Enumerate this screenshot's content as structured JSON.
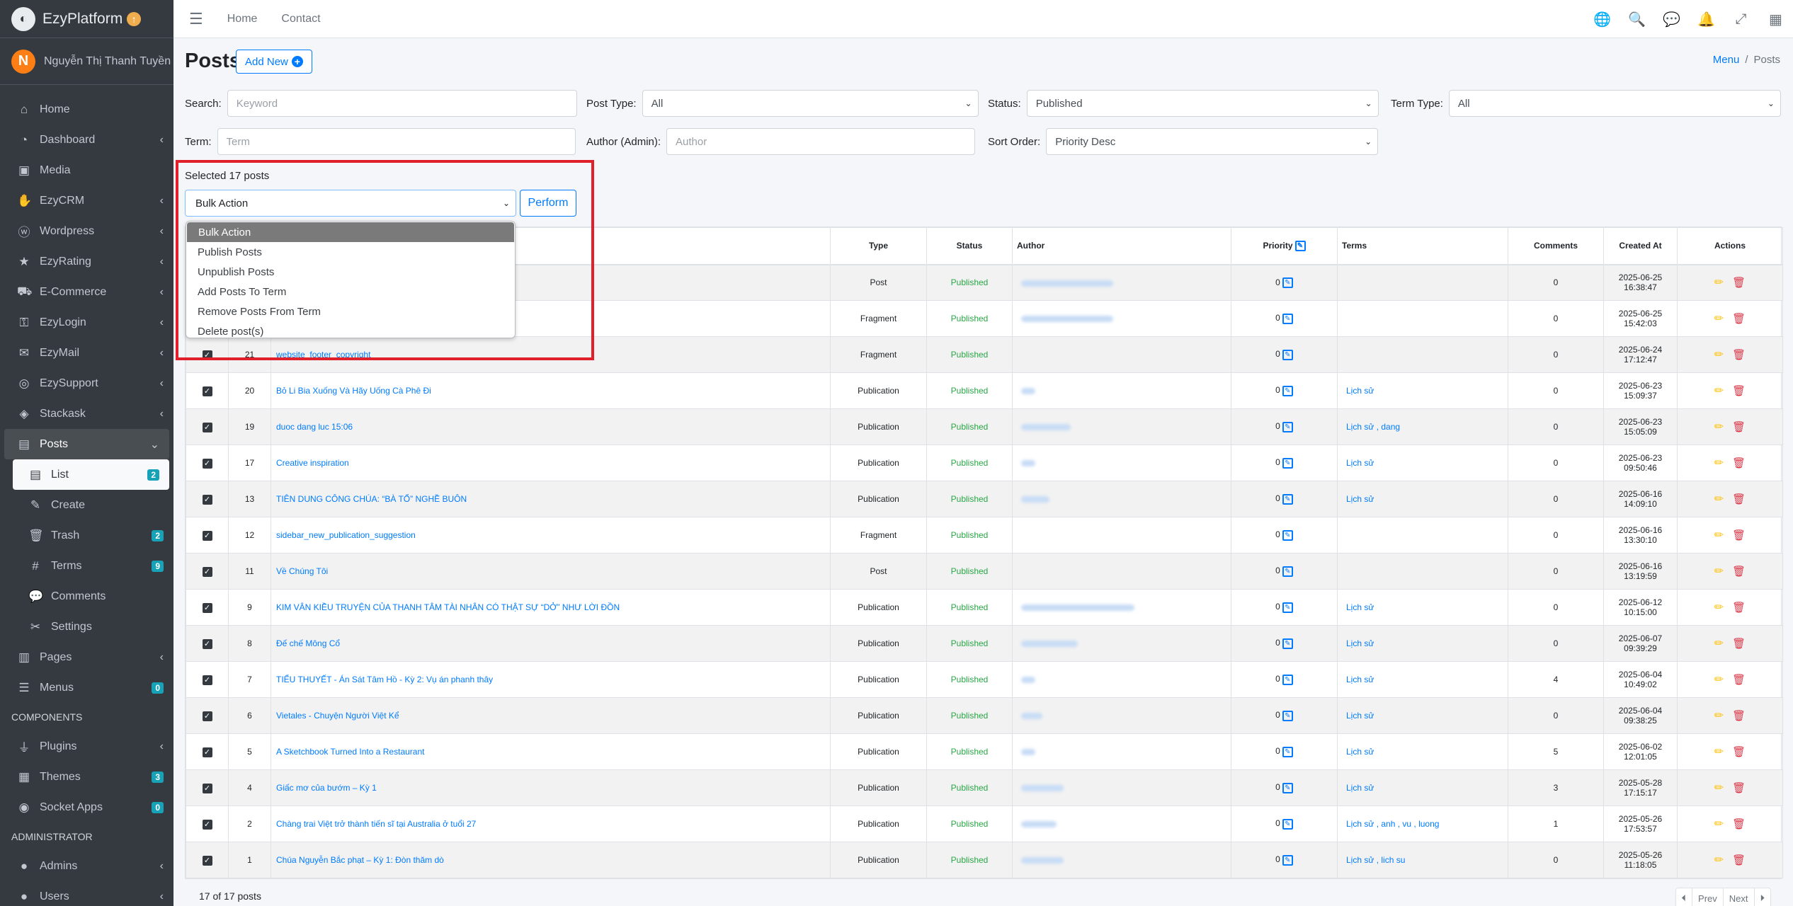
{
  "brand": {
    "name": "EzyPlatform"
  },
  "user": {
    "initial": "N",
    "name": "Nguyễn Thị Thanh Tuyền"
  },
  "sidebar": {
    "items": [
      {
        "label": "Home",
        "icon": "home-icon"
      },
      {
        "label": "Dashboard",
        "icon": "dashboard-icon"
      },
      {
        "label": "Media",
        "icon": "media-icon"
      },
      {
        "label": "EzyCRM",
        "icon": "crm-icon"
      },
      {
        "label": "Wordpress",
        "icon": "wordpress-icon"
      },
      {
        "label": "EzyRating",
        "icon": "star-icon"
      },
      {
        "label": "E-Commerce",
        "icon": "cart-icon"
      },
      {
        "label": "EzyLogin",
        "icon": "login-icon"
      },
      {
        "label": "EzyMail",
        "icon": "mail-icon"
      },
      {
        "label": "EzySupport",
        "icon": "support-icon"
      },
      {
        "label": "Stackask",
        "icon": "stack-icon"
      },
      {
        "label": "Posts",
        "icon": "posts-icon"
      }
    ],
    "posts_sub": [
      {
        "label": "List",
        "badge": "2"
      },
      {
        "label": "Create",
        "badge": ""
      },
      {
        "label": "Trash",
        "badge": "2"
      },
      {
        "label": "Terms",
        "badge": "9"
      },
      {
        "label": "Comments",
        "badge": ""
      },
      {
        "label": "Settings",
        "badge": ""
      }
    ],
    "after": [
      {
        "label": "Pages",
        "badge": ""
      },
      {
        "label": "Menus",
        "badge": "0"
      }
    ],
    "components_header": "COMPONENTS",
    "components": [
      {
        "label": "Plugins",
        "badge": ""
      },
      {
        "label": "Themes",
        "badge": "3"
      },
      {
        "label": "Socket Apps",
        "badge": "0"
      }
    ],
    "admin_header": "ADMINISTRATOR",
    "admin": [
      {
        "label": "Admins"
      },
      {
        "label": "Users"
      }
    ]
  },
  "topnav": {
    "home": "Home",
    "contact": "Contact"
  },
  "page": {
    "title": "Posts",
    "add_new": "Add New"
  },
  "breadcrumb": {
    "menu": "Menu",
    "current": "Posts"
  },
  "filters": {
    "search_label": "Search:",
    "search_placeholder": "Keyword",
    "post_type_label": "Post Type:",
    "post_type_value": "All",
    "status_label": "Status:",
    "status_value": "Published",
    "term_type_label": "Term Type:",
    "term_type_value": "All",
    "term_label": "Term:",
    "term_placeholder": "Term",
    "author_label": "Author (Admin):",
    "author_placeholder": "Author",
    "sort_label": "Sort Order:",
    "sort_value": "Priority Desc"
  },
  "bulk": {
    "selected_text": "Selected 17 posts",
    "select_value": "Bulk Action",
    "perform": "Perform",
    "options": [
      "Bulk Action",
      "Publish Posts",
      "Unpublish Posts",
      "Add Posts To Term",
      "Remove Posts From Term",
      "Delete post(s)"
    ]
  },
  "table": {
    "headers": {
      "type": "Type",
      "status": "Status",
      "author": "Author",
      "priority": "Priority",
      "terms": "Terms",
      "comments": "Comments",
      "created_at": "Created At",
      "actions": "Actions"
    },
    "rows": [
      {
        "id": "",
        "title": "",
        "type": "Post",
        "status": "Published",
        "priority": "0",
        "terms": "",
        "comments": "0",
        "created": "2025-06-25 16:38:47"
      },
      {
        "id": "",
        "title": "",
        "type": "Fragment",
        "status": "Published",
        "priority": "0",
        "terms": "",
        "comments": "0",
        "created": "2025-06-25 15:42:03"
      },
      {
        "id": "21",
        "title": "website_footer_copyright",
        "type": "Fragment",
        "status": "Published",
        "priority": "0",
        "terms": "",
        "comments": "0",
        "created": "2025-06-24 17:12:47"
      },
      {
        "id": "20",
        "title": "Bỏ Li Bia Xuống Và Hãy Uống Cà Phê Đi",
        "type": "Publication",
        "status": "Published",
        "priority": "0",
        "terms": "Lịch sử",
        "comments": "0",
        "created": "2025-06-23 15:09:37"
      },
      {
        "id": "19",
        "title": "duoc dang luc 15:06",
        "type": "Publication",
        "status": "Published",
        "priority": "0",
        "terms": "Lịch sử , dang",
        "comments": "0",
        "created": "2025-06-23 15:05:09"
      },
      {
        "id": "17",
        "title": "Creative inspiration",
        "type": "Publication",
        "status": "Published",
        "priority": "0",
        "terms": "Lịch sử",
        "comments": "0",
        "created": "2025-06-23 09:50:46"
      },
      {
        "id": "13",
        "title": "TIÊN DUNG CÔNG CHÚA: “BÀ TỔ” NGHỀ BUÔN",
        "type": "Publication",
        "status": "Published",
        "priority": "0",
        "terms": "Lịch sử",
        "comments": "0",
        "created": "2025-06-16 14:09:10"
      },
      {
        "id": "12",
        "title": "sidebar_new_publication_suggestion",
        "type": "Fragment",
        "status": "Published",
        "priority": "0",
        "terms": "",
        "comments": "0",
        "created": "2025-06-16 13:30:10"
      },
      {
        "id": "11",
        "title": "Về Chúng Tôi",
        "type": "Post",
        "status": "Published",
        "priority": "0",
        "terms": "",
        "comments": "0",
        "created": "2025-06-16 13:19:59"
      },
      {
        "id": "9",
        "title": "KIM VÂN KIỀU TRUYỆN CỦA THANH TÂM TÀI NHÂN CÓ THẬT SỰ “DỞ” NHƯ LỜI ĐỒN",
        "type": "Publication",
        "status": "Published",
        "priority": "0",
        "terms": "Lịch sử",
        "comments": "0",
        "created": "2025-06-12 10:15:00"
      },
      {
        "id": "8",
        "title": "Đế chế Mông Cổ",
        "type": "Publication",
        "status": "Published",
        "priority": "0",
        "terms": "Lịch sử",
        "comments": "0",
        "created": "2025-06-07 09:39:29"
      },
      {
        "id": "7",
        "title": "TIỂU THUYẾT - Án Sát Tâm Hồ - Kỳ 2: Vụ án phanh thây",
        "type": "Publication",
        "status": "Published",
        "priority": "0",
        "terms": "Lịch sử",
        "comments": "4",
        "created": "2025-06-04 10:49:02"
      },
      {
        "id": "6",
        "title": "Vietales - Chuyện Người Việt Kể",
        "type": "Publication",
        "status": "Published",
        "priority": "0",
        "terms": "Lịch sử",
        "comments": "0",
        "created": "2025-06-04 09:38:25"
      },
      {
        "id": "5",
        "title": "A Sketchbook Turned Into a Restaurant",
        "type": "Publication",
        "status": "Published",
        "priority": "0",
        "terms": "Lịch sử",
        "comments": "5",
        "created": "2025-06-02 12:01:05"
      },
      {
        "id": "4",
        "title": "Giấc mơ của bướm – Kỳ 1",
        "type": "Publication",
        "status": "Published",
        "priority": "0",
        "terms": "Lịch sử",
        "comments": "3",
        "created": "2025-05-28 17:15:17"
      },
      {
        "id": "2",
        "title": "Chàng trai Việt trở thành tiến sĩ tại Australia ở tuổi 27",
        "type": "Publication",
        "status": "Published",
        "priority": "0",
        "terms": "Lịch sử , anh , vu , luong",
        "comments": "1",
        "created": "2025-05-26 17:53:57"
      },
      {
        "id": "1",
        "title": "Chúa Nguyễn Bắc phạt – Kỳ 1: Đòn thăm dò",
        "type": "Publication",
        "status": "Published",
        "priority": "0",
        "terms": "Lịch sử , lich su",
        "comments": "0",
        "created": "2025-05-26 11:18:05"
      }
    ]
  },
  "footer": {
    "count": "17 of 17 posts",
    "prev": "Prev",
    "next": "Next"
  },
  "colors": {
    "primary": "#007bff",
    "sidebar": "#343a40",
    "success": "#28a745",
    "danger": "#dc3545",
    "highlight": "#e0202a"
  }
}
